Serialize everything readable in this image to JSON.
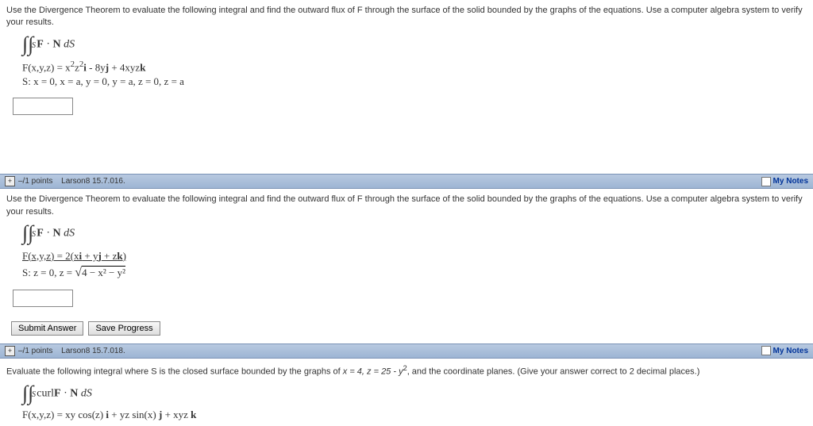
{
  "q1": {
    "prompt": "Use the Divergence Theorem to evaluate the following integral and find the outward flux of F through the surface of the solid bounded by the graphs of the equations. Use a computer algebra system to verify your results.",
    "integrand": "F · N dS",
    "fdef_prefix": "F(x,y,z) = x",
    "f_exp1": "2",
    "f_mid1": "z",
    "f_exp2": "2",
    "f_i": "i",
    "f_mid2": " - 8y",
    "f_j": "j",
    "f_mid3": " + 4xyz",
    "f_k": "k",
    "sdef": "S: x = 0, x = a, y = 0, y = a, z = 0, z = a"
  },
  "h2": {
    "points": "–/1 points",
    "ref": "Larson8 15.7.016.",
    "notes": "My Notes"
  },
  "q2": {
    "prompt": "Use the Divergence Theorem to evaluate the following integral and find the outward flux of F through the surface of the solid bounded by the graphs of the equations. Use a computer algebra system to verify your results.",
    "integrand": "F · N dS",
    "fdef_prefix": "F(x,y,z) = 2(x",
    "f_i": "i",
    "f_mid1": " + y",
    "f_j": "j",
    "f_mid2": " + z",
    "f_k": "k",
    "f_close": ")",
    "sdef_prefix": "S: z = 0, z = ",
    "sqrt_inner": "4 − x² − y²",
    "submit": "Submit Answer",
    "save": "Save Progress"
  },
  "h3": {
    "points": "–/1 points",
    "ref": "Larson8 15.7.018.",
    "notes": "My Notes"
  },
  "q3": {
    "prompt_a": "Evaluate the following integral where S is the closed surface bounded by the graphs of ",
    "prompt_b": "x = 4, z = 25 - y",
    "prompt_c": ", and the coordinate planes. (Give your answer correct to 2 decimal places.)",
    "curl": "curl",
    "integrand": "F · N dS",
    "fdef_a": "F(x,y,z) = xy cos(z) ",
    "f_i": "i",
    "fdef_b": " + yz sin(x) ",
    "f_j": "j",
    "fdef_c": " + xyz ",
    "f_k": "k"
  }
}
